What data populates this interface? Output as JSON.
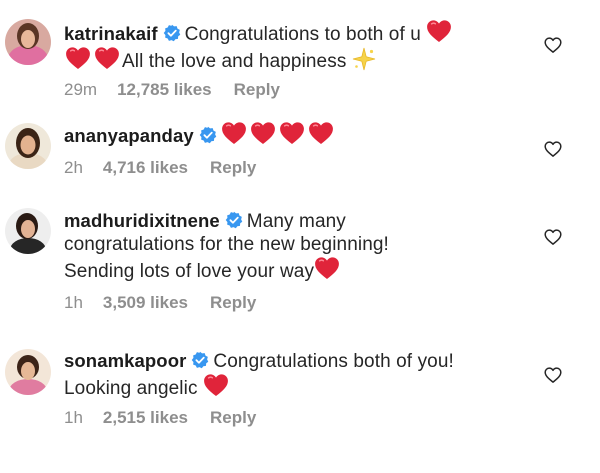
{
  "comments": [
    {
      "username": "katrinakaif",
      "text_line1": "Congratulations to both of u",
      "text_line2": "All the love and happiness",
      "time": "29m",
      "likes": "12,785 likes",
      "reply": "Reply"
    },
    {
      "username": "ananyapanday",
      "time": "2h",
      "likes": "4,716 likes",
      "reply": "Reply"
    },
    {
      "username": "madhuridixitnene",
      "text_line1": "Many many",
      "text_line2": "congratulations for the new beginning!",
      "text_line3": "Sending lots of love your way",
      "time": "1h",
      "likes": "3,509 likes",
      "reply": "Reply"
    },
    {
      "username": "sonamkapoor",
      "text_line1": "Congratulations both of you!",
      "text_line2": "Looking angelic",
      "time": "1h",
      "likes": "2,515 likes",
      "reply": "Reply"
    }
  ],
  "colors": {
    "heart": "#e0243a",
    "verified": "#3897f0",
    "meta": "#8e8e8e",
    "text": "#262626"
  },
  "icons": {
    "verified": "verified-badge-icon",
    "heart": "red-heart-emoji-icon",
    "sparkle": "sparkle-emoji-icon",
    "like": "heart-outline-icon"
  }
}
